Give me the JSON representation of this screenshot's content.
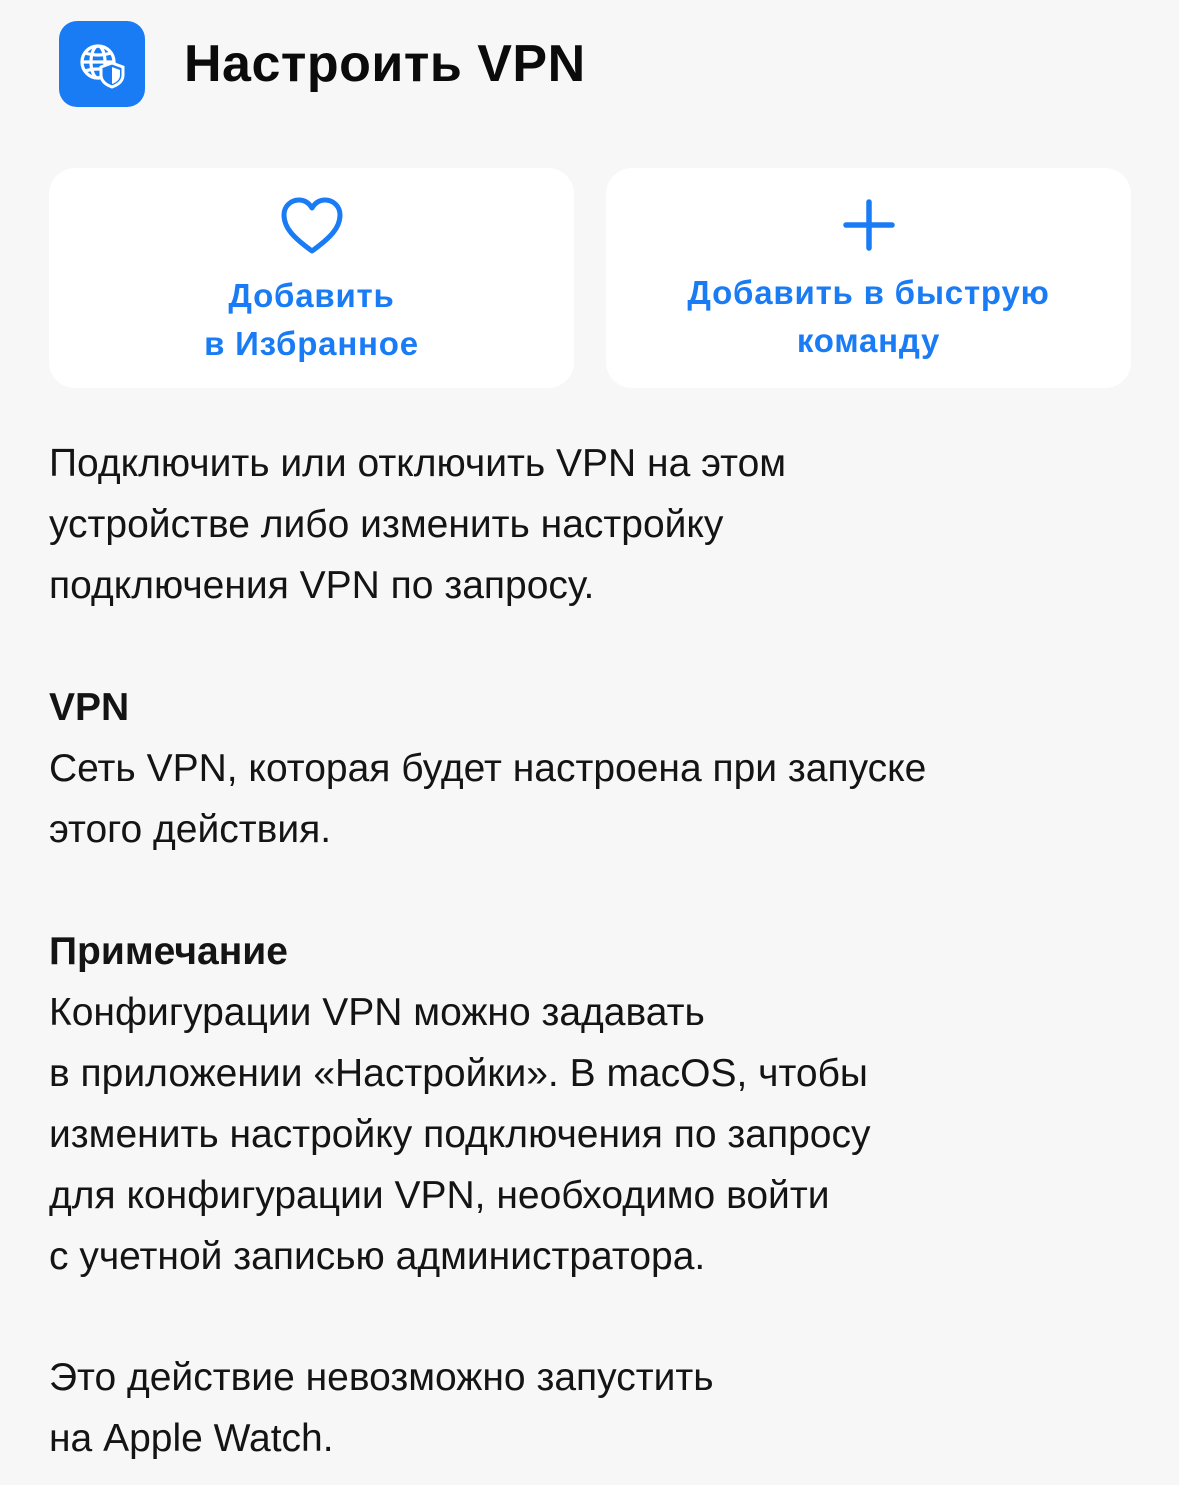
{
  "header": {
    "icon": "globe-shield-icon",
    "title": "Настроить VPN"
  },
  "actions": {
    "favorite": {
      "icon": "heart-icon",
      "line1": "Добавить",
      "line2": "в Избранное"
    },
    "shortcut": {
      "icon": "plus-icon",
      "line1": "Добавить в быструю",
      "line2": "команду"
    }
  },
  "description": {
    "lines": [
      "Подключить или отключить VPN на этом",
      "устройстве либо изменить настройку",
      "подключения VPN по запросу."
    ]
  },
  "vpn_section": {
    "heading": "VPN",
    "lines": [
      "Сеть VPN, которая будет настроена при запуске",
      "этого действия."
    ]
  },
  "note_section": {
    "heading": "Примечание",
    "lines": [
      "Конфигурации VPN можно задавать",
      "в приложении «Настройки». В macOS, чтобы",
      "изменить настройку подключения по запросу",
      "для конфигурации VPN, необходимо войти",
      "с учетной записью администратора."
    ]
  },
  "watch_note": {
    "lines": [
      "Это действие невозможно запустить",
      "на Apple Watch."
    ]
  },
  "colors": {
    "accent": "#1a7cf5",
    "background": "#f7f7f7",
    "card": "#ffffff",
    "text": "#141414"
  }
}
